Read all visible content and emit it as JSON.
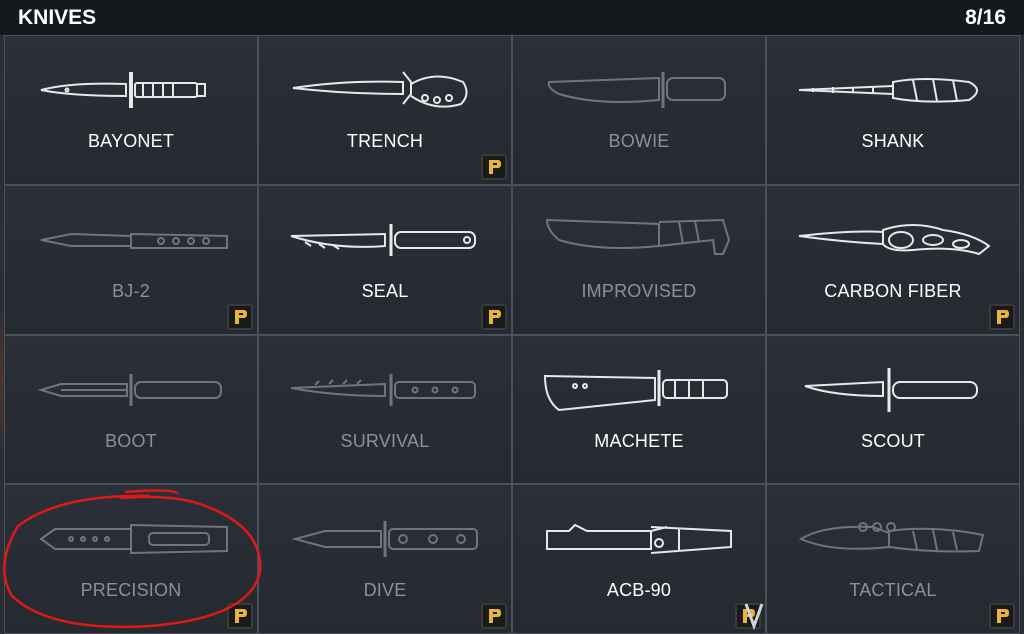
{
  "header": {
    "title": "KNIVES",
    "count": "8/16"
  },
  "colors": {
    "badge_gold": "#e8b43a",
    "annotation_red": "#e01818",
    "unlocked_text": "#ffffff",
    "locked_text": "#8b919a"
  },
  "knives": [
    {
      "name": "BAYONET",
      "locked": false,
      "premium": false
    },
    {
      "name": "TRENCH",
      "locked": false,
      "premium": true
    },
    {
      "name": "BOWIE",
      "locked": true,
      "premium": false
    },
    {
      "name": "SHANK",
      "locked": false,
      "premium": false
    },
    {
      "name": "BJ-2",
      "locked": true,
      "premium": true
    },
    {
      "name": "SEAL",
      "locked": false,
      "premium": true
    },
    {
      "name": "IMPROVISED",
      "locked": true,
      "premium": false
    },
    {
      "name": "CARBON FIBER",
      "locked": false,
      "premium": true
    },
    {
      "name": "BOOT",
      "locked": true,
      "premium": false
    },
    {
      "name": "SURVIVAL",
      "locked": true,
      "premium": false
    },
    {
      "name": "MACHETE",
      "locked": false,
      "premium": false
    },
    {
      "name": "SCOUT",
      "locked": false,
      "premium": false
    },
    {
      "name": "PRECISION",
      "locked": true,
      "premium": true
    },
    {
      "name": "DIVE",
      "locked": true,
      "premium": true
    },
    {
      "name": "ACB-90",
      "locked": false,
      "premium": true
    },
    {
      "name": "TACTICAL",
      "locked": true,
      "premium": true
    }
  ],
  "icons": {
    "premium_badge": "premium-badge-icon",
    "scroll_down": "chevron-down-icon"
  }
}
